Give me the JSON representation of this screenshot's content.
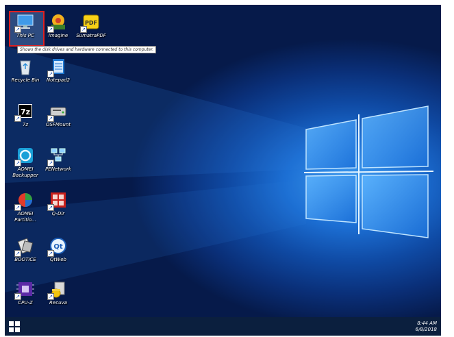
{
  "tooltip": "Shows the disk drives and hardware connected to this computer.",
  "icons": [
    {
      "label": "This PC",
      "icon": "this-pc-icon"
    },
    {
      "label": "Imagine",
      "icon": "imagine-icon"
    },
    {
      "label": "SumatraPDF",
      "icon": "sumatrapdf-icon"
    },
    {
      "label": "Recycle Bin",
      "icon": "recycle-bin-icon"
    },
    {
      "label": "Notepad2",
      "icon": "notepad2-icon"
    },
    {
      "label": "7z",
      "icon": "7z-icon"
    },
    {
      "label": "OSFMount",
      "icon": "osfmount-icon"
    },
    {
      "label": "AOMEI Backupper",
      "icon": "aomei-backupper-icon"
    },
    {
      "label": "PENetwork",
      "icon": "penetwork-icon"
    },
    {
      "label": "AOMEI Partitio...",
      "icon": "aomei-partition-icon"
    },
    {
      "label": "Q-Dir",
      "icon": "q-dir-icon"
    },
    {
      "label": "BOOTICE",
      "icon": "bootice-icon"
    },
    {
      "label": "QtWeb",
      "icon": "qtweb-icon"
    },
    {
      "label": "CPU-Z",
      "icon": "cpu-z-icon"
    },
    {
      "label": "Recuva",
      "icon": "recuva-icon"
    }
  ],
  "taskbar": {
    "time": "8:44 AM",
    "date": "6/8/2018"
  },
  "colors": {
    "selection_border": "#e02020",
    "taskbar": "#0b1f3e",
    "wallpaper": "#0f4aa4"
  }
}
